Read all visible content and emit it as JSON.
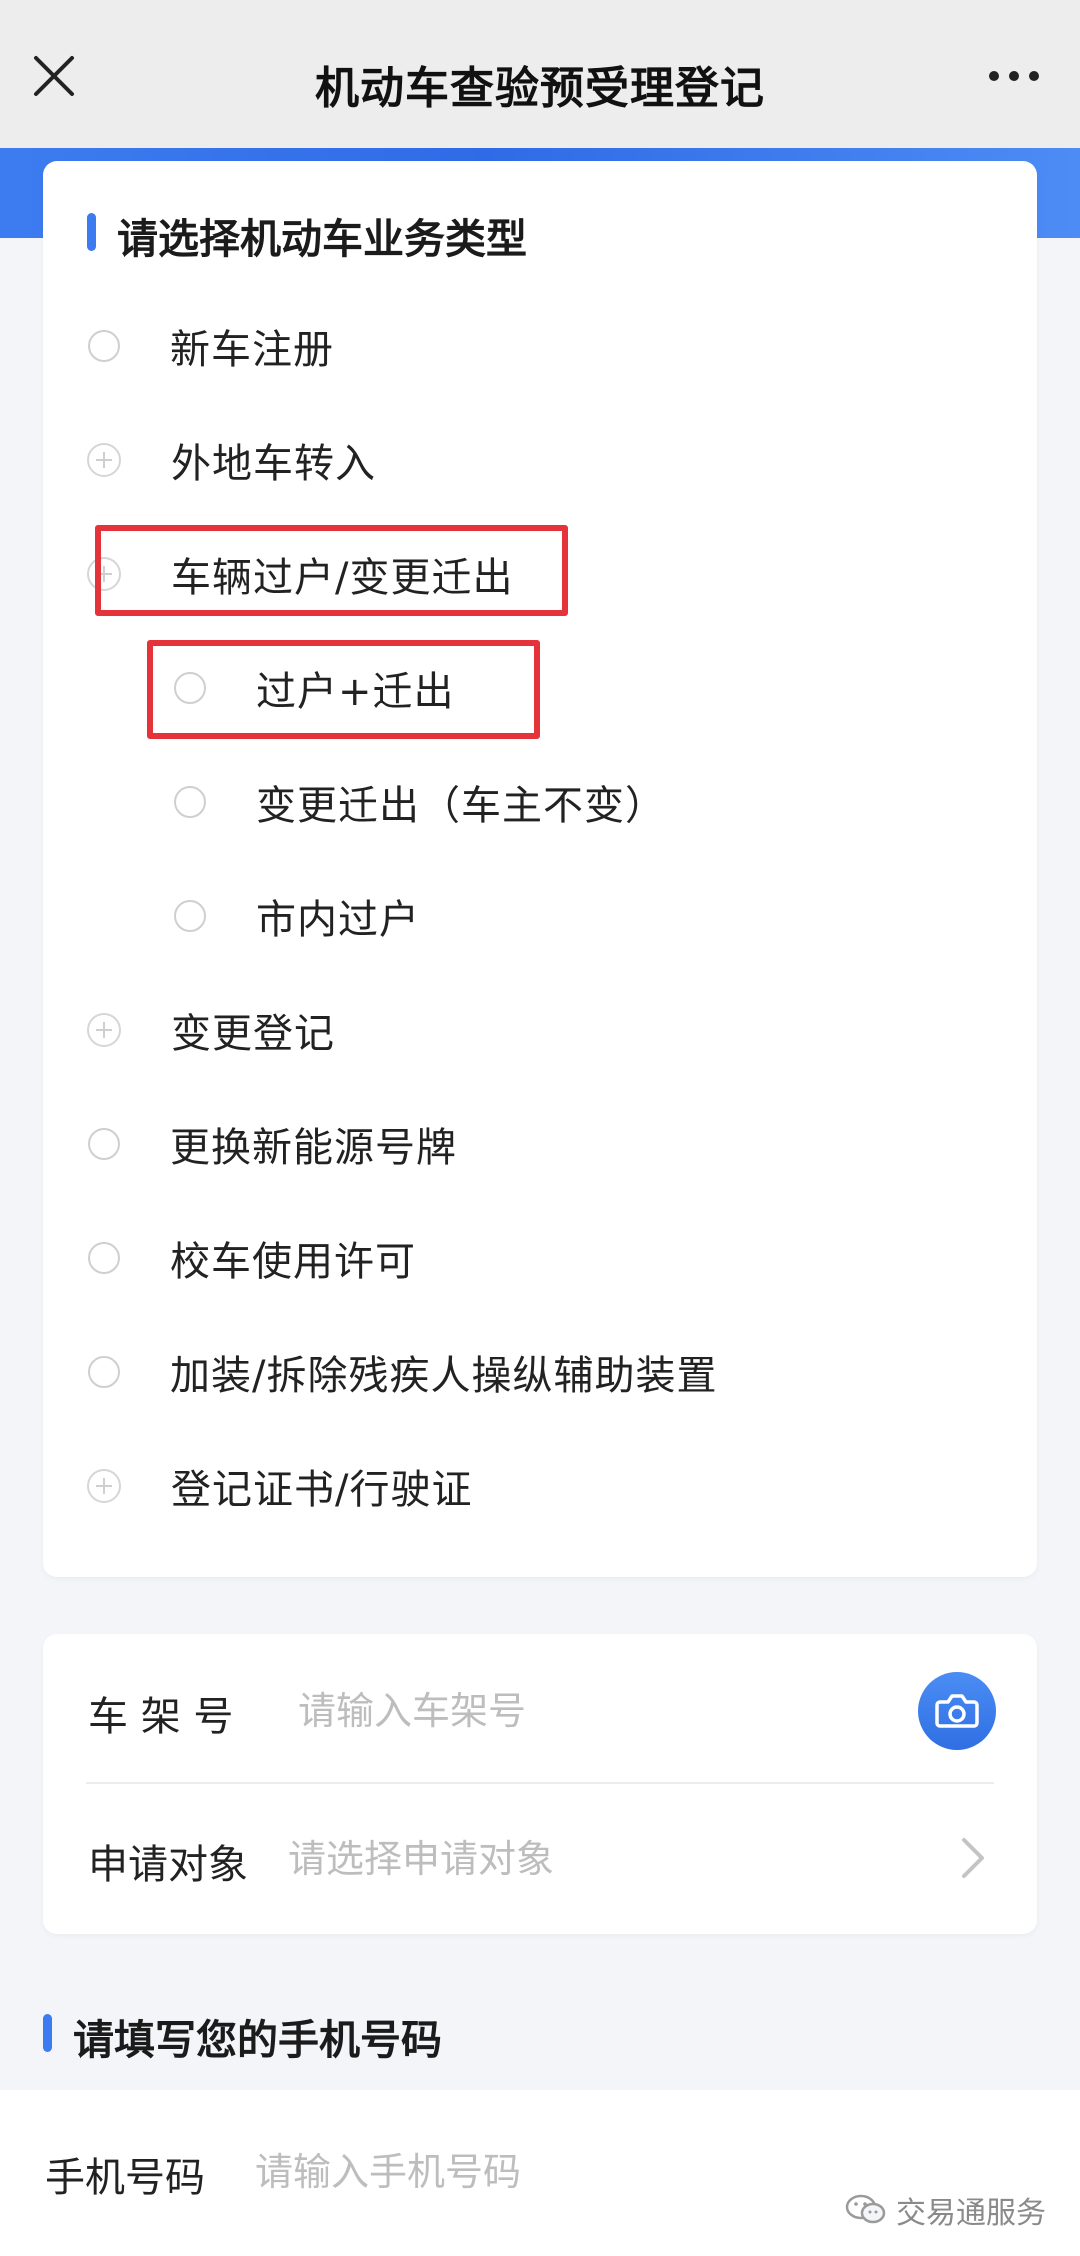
{
  "nav": {
    "title": "机动车查验预受理登记"
  },
  "business_type": {
    "section_title": "请选择机动车业务类型",
    "options": [
      {
        "label": "新车注册",
        "control": "radio"
      },
      {
        "label": "外地车转入",
        "control": "expand"
      },
      {
        "label": "车辆过户/变更迁出",
        "control": "expand",
        "expanded": true
      },
      {
        "label": "过户+迁出",
        "control": "radio",
        "level": 2
      },
      {
        "label": "变更迁出（车主不变）",
        "control": "radio",
        "level": 2
      },
      {
        "label": "市内过户",
        "control": "radio",
        "level": 2
      },
      {
        "label": "变更登记",
        "control": "expand"
      },
      {
        "label": "更换新能源号牌",
        "control": "radio"
      },
      {
        "label": "校车使用许可",
        "control": "radio"
      },
      {
        "label": "加装/拆除残疾人操纵辅助装置",
        "control": "radio"
      },
      {
        "label": "登记证书/行驶证",
        "control": "expand"
      }
    ]
  },
  "vehicle": {
    "vin_label": "车 架 号",
    "vin_placeholder": "请输入车架号",
    "applicant_label": "申请对象",
    "applicant_placeholder": "请选择申请对象"
  },
  "phone": {
    "section_title": "请填写您的手机号码",
    "label": "手机号码",
    "placeholder": "请输入手机号码"
  },
  "watermark": {
    "text": "交易通服务"
  },
  "colors": {
    "accent": "#3d7cf0",
    "highlight": "#e5333c",
    "placeholder": "#bdbdbd"
  }
}
